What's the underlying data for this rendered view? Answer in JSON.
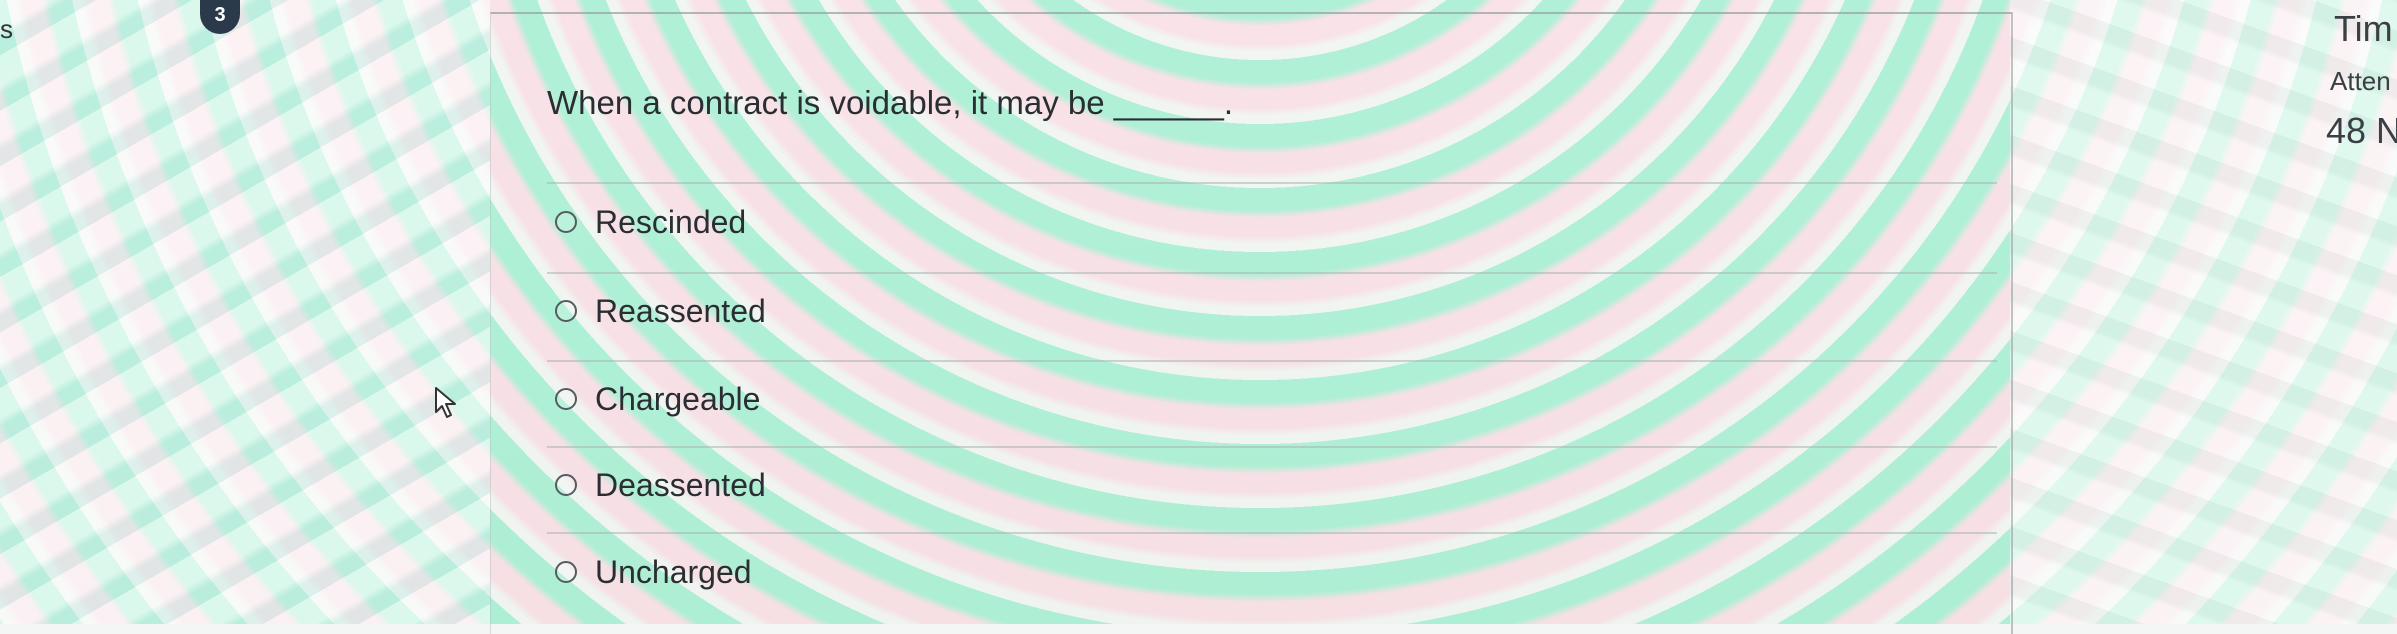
{
  "question": {
    "number": "3",
    "text": "When a contract is voidable, it may be ______."
  },
  "options": [
    {
      "label": "Rescinded"
    },
    {
      "label": "Reassented"
    },
    {
      "label": "Chargeable"
    },
    {
      "label": "Deassented"
    },
    {
      "label": "Uncharged"
    }
  ],
  "left_fragment": "s",
  "timer_panel": {
    "title": "Tim",
    "attempts": "Atten",
    "remaining": "48 N"
  }
}
